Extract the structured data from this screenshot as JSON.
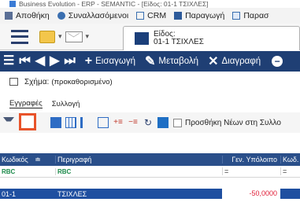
{
  "window": {
    "title": "Business Evolution - ERP - SEMANTIC - [Είδος: 01-1  ΤΣΙΧΛΕΣ]"
  },
  "menu": {
    "items": [
      {
        "label": "Αποθήκη",
        "icon": "warehouse-icon"
      },
      {
        "label": "Συναλλασόμενοι",
        "icon": "people-icon"
      },
      {
        "label": "CRM",
        "icon": "crm-icon"
      },
      {
        "label": "Παραγωγή",
        "icon": "production-icon"
      },
      {
        "label": "Παρασ",
        "icon": "document-icon"
      }
    ]
  },
  "document_tab": {
    "line1": "Είδος:",
    "line2": "01-1  ΤΣΙΧΛΕΣ"
  },
  "actions": {
    "insert": "Εισαγωγή",
    "modify": "Μεταβολή",
    "delete": "Διαγραφή"
  },
  "schema": {
    "label": "Σχήμα:",
    "value": "(προκαθορισμένο)"
  },
  "subtabs": [
    "Εγγραφές",
    "Συλλογή"
  ],
  "grid_toolbar": {
    "checkbox_label": "Προσθήκη Νέων στη Συλλο",
    "checkbox_checked": false
  },
  "grid": {
    "columns": [
      "Κωδικός",
      "Περιγραφή",
      "Γεν. Υπόλοιπο",
      "Κωδ."
    ],
    "filter_tags": [
      "RBC",
      "RBC",
      "=",
      "="
    ],
    "rows": [
      {
        "code": "01-1",
        "description": "ΤΣΙΧΛΕΣ",
        "balance": "-50,0000",
        "code2": ""
      }
    ]
  },
  "colors": {
    "action_bar": "#1f3f74",
    "grid_header": "#2a4f8a",
    "selected_row": "#1f4fa0",
    "highlight": "#e8532a",
    "negative_value": "#e0203a"
  }
}
